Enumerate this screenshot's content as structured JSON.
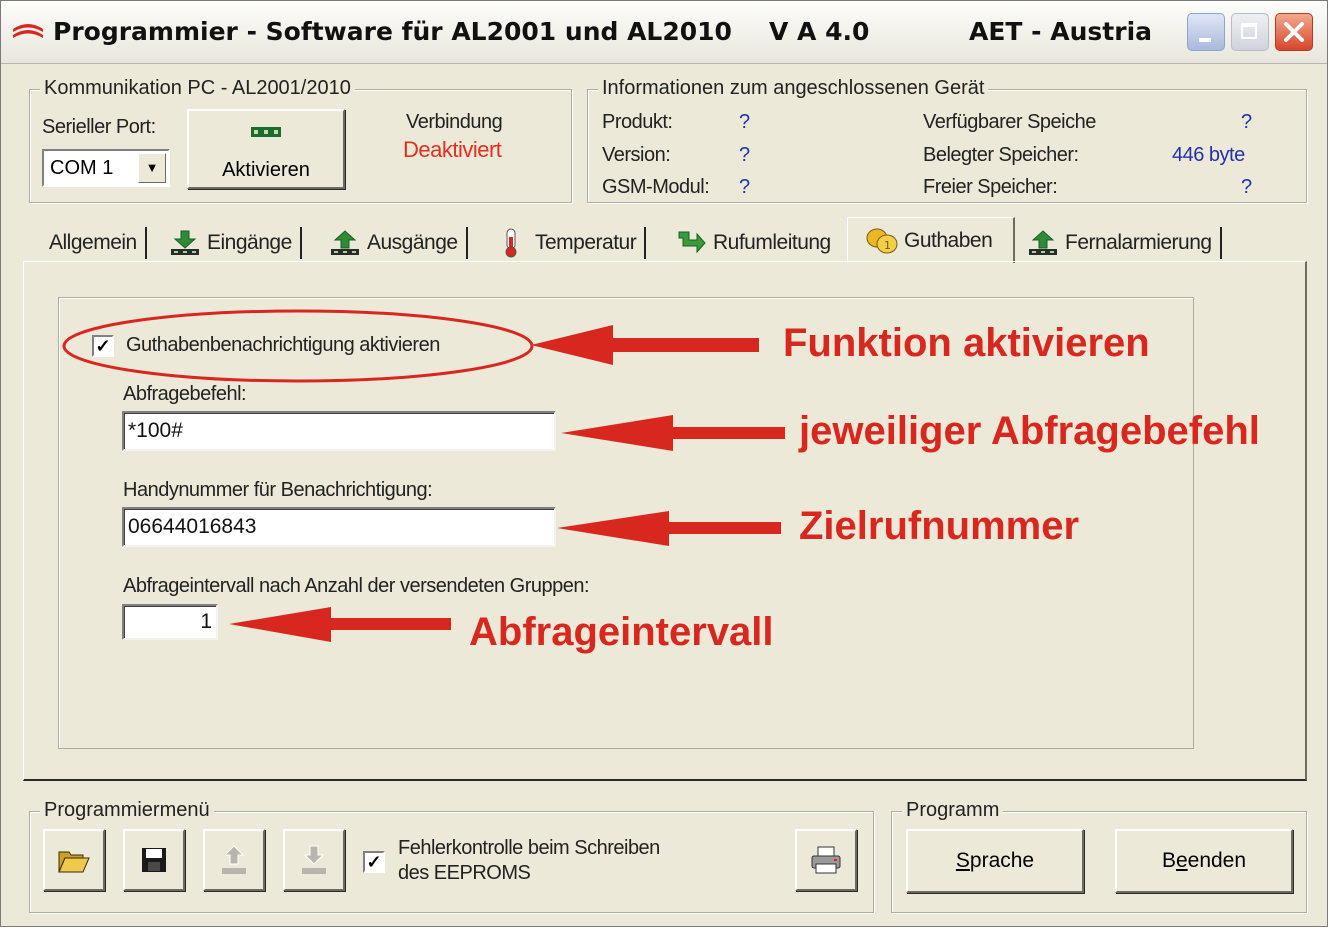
{
  "window": {
    "title_app": "Programmier - Software für AL2001 und AL2010",
    "version": "V A 4.0",
    "company": "AET - Austria"
  },
  "communication": {
    "legend": "Kommunikation PC - AL2001/2010",
    "port_label": "Serieller Port:",
    "port_value": "COM 1",
    "activate_label": "Aktivieren",
    "connection_label": "Verbindung",
    "connection_status": "Deaktiviert",
    "status_color": "#e03020"
  },
  "device_info": {
    "legend": "Informationen zum angeschlossenen Gerät",
    "product_label": "Produkt:",
    "product_value": "?",
    "version_label": "Version:",
    "version_value": "?",
    "gsm_label": "GSM-Modul:",
    "gsm_value": "?",
    "avail_mem_label": "Verfügbarer Speiche",
    "avail_mem_value": "?",
    "used_mem_label": "Belegter Speicher:",
    "used_mem_value": "446 byte",
    "free_mem_label": "Freier Speicher:",
    "free_mem_value": "?"
  },
  "tabs": [
    {
      "label": "Allgemein",
      "icon": "none"
    },
    {
      "label": "Eingänge",
      "icon": "input-icon"
    },
    {
      "label": "Ausgänge",
      "icon": "output-icon"
    },
    {
      "label": "Temperatur",
      "icon": "thermometer-icon"
    },
    {
      "label": "Rufumleitung",
      "icon": "call-forward-icon"
    },
    {
      "label": "Guthaben",
      "icon": "coins-icon",
      "active": true
    },
    {
      "label": "Fernalarmierung",
      "icon": "remote-alarm-icon"
    }
  ],
  "guthaben": {
    "enable_label": "Guthabenbenachrichtigung aktivieren",
    "enable_checked": true,
    "query_cmd_label": "Abfragebefehl:",
    "query_cmd_value": "*100#",
    "phone_label": "Handynummer für Benachrichtigung:",
    "phone_value": "06644016843",
    "interval_label": "Abfrageintervall nach Anzahl der versendeten Gruppen:",
    "interval_value": "1"
  },
  "annotations": {
    "a1": "Funktion aktivieren",
    "a2": "jeweiliger Abfragebefehl",
    "a3": "Zielrufnummer",
    "a4": "Abfrageintervall",
    "color": "#d8271f"
  },
  "prog_menu": {
    "legend": "Programmiermenü",
    "error_check_line1": "Fehlerkontrolle beim Schreiben",
    "error_check_line2": "des EEPROMS",
    "error_check_checked": true
  },
  "program": {
    "legend": "Programm",
    "language_pre": "",
    "language_u": "S",
    "language_post": "prache",
    "exit_pre": "B",
    "exit_u": "e",
    "exit_post": "enden"
  }
}
